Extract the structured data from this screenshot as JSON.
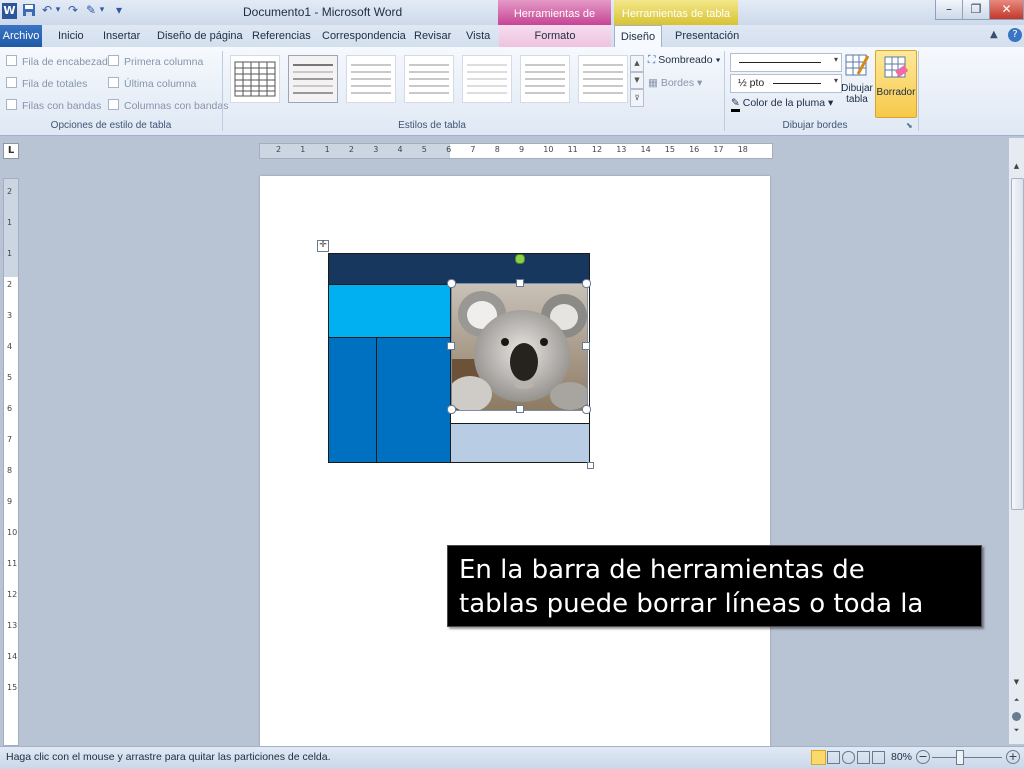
{
  "window": {
    "title": "Documento1 - Microsoft Word",
    "context_headers": {
      "imagen": "Herramientas de imagen",
      "tabla": "Herramientas de tabla"
    },
    "controls": {
      "minimize": "–",
      "restore": "❐",
      "close": "✕"
    }
  },
  "qat": {
    "word_logo": "W",
    "save": "💾",
    "undo": "↶",
    "redo": "↷",
    "brush": "✎",
    "customize": "▾"
  },
  "tabs": [
    {
      "label": "Archivo"
    },
    {
      "label": "Inicio"
    },
    {
      "label": "Insertar"
    },
    {
      "label": "Diseño de página"
    },
    {
      "label": "Referencias"
    },
    {
      "label": "Correspondencia"
    },
    {
      "label": "Revisar"
    },
    {
      "label": "Vista"
    },
    {
      "label": "Formato"
    },
    {
      "label": "Diseño"
    },
    {
      "label": "Presentación"
    }
  ],
  "ribbon": {
    "style_options": {
      "label": "Opciones de estilo de tabla",
      "items": [
        "Fila de encabezado",
        "Primera columna",
        "Fila de totales",
        "Última columna",
        "Filas con bandas",
        "Columnas con bandas"
      ]
    },
    "table_styles": {
      "label": "Estilos de tabla"
    },
    "shading": "Sombreado",
    "borders": "Bordes",
    "draw_borders": {
      "label": "Dibujar bordes",
      "pen_weight": "½ pto",
      "pen_color": "Color de la pluma",
      "draw_table": [
        "Dibujar",
        "tabla"
      ],
      "eraser": "Borrador"
    }
  },
  "ruler": {
    "h_ticks": [
      "2",
      "1",
      "1",
      "2",
      "3",
      "4",
      "5",
      "6",
      "7",
      "8",
      "9",
      "10",
      "11",
      "12",
      "13",
      "14",
      "15",
      "16",
      "17",
      "18"
    ],
    "v_ticks": [
      "2",
      "1",
      "1",
      "2",
      "3",
      "4",
      "5",
      "6",
      "7",
      "8",
      "9",
      "10",
      "11",
      "12",
      "13",
      "14",
      "15"
    ]
  },
  "status": {
    "message": "Haga clic con el mouse y arrastre para quitar las particiones de celda.",
    "zoom": "80%"
  },
  "colors": {
    "table_header": "#17375e",
    "cell_cyan": "#00b0f0",
    "cell_blue": "#0070c0",
    "cell_light": "#b8cce4",
    "eraser_active": "#fbd96a",
    "ctx_imagen": "#c64494",
    "ctx_tabla": "#e8d44a"
  },
  "caption": {
    "line1": "En la barra de herramientas de",
    "line2": "tablas puede borrar líneas o toda la"
  }
}
